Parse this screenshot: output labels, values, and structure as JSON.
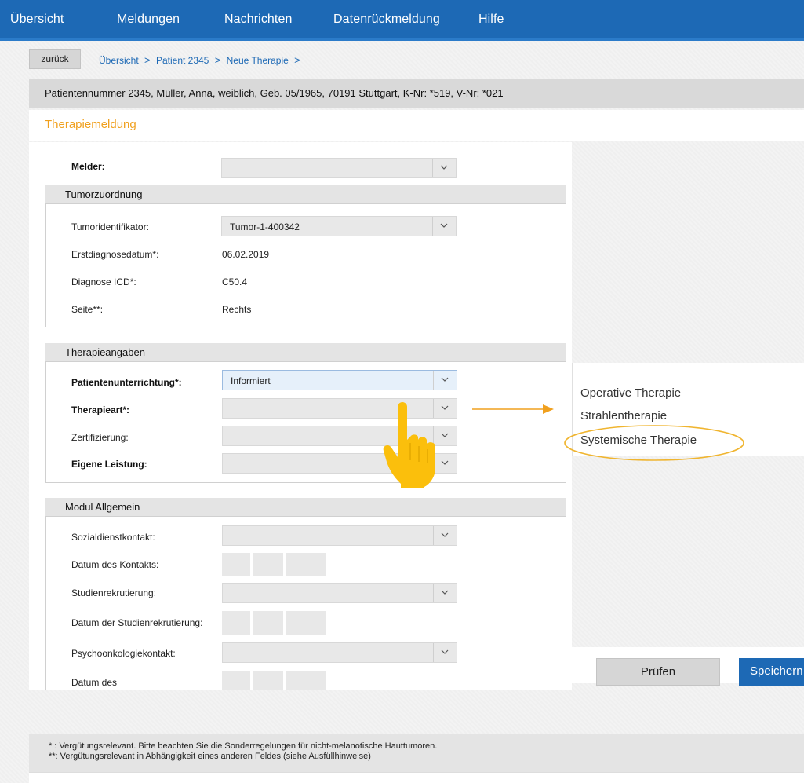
{
  "nav": {
    "items": [
      "Übersicht",
      "Meldungen",
      "Nachrichten",
      "Datenrückmeldung",
      "Hilfe"
    ]
  },
  "toolbar": {
    "back_label": "zurück",
    "breadcrumb": [
      "Übersicht",
      "Patient 2345",
      "Neue Therapie"
    ],
    "separator": ">"
  },
  "patient": {
    "info": "Patientennummer 2345, Müller, Anna, weiblich, Geb. 05/1965, 70191 Stuttgart, K-Nr: *519, V-Nr: *021"
  },
  "page": {
    "title": "Therapiemeldung"
  },
  "form": {
    "melder": {
      "label": "Melder:",
      "value": ""
    },
    "tumor": {
      "heading": "Tumorzuordnung",
      "identifikator_label": "Tumoridentifikator:",
      "identifikator_value": "Tumor-1-400342",
      "erstdiagnose_label": "Erstdiagnosedatum*:",
      "erstdiagnose_value": "06.02.2019",
      "icd_label": "Diagnose ICD*:",
      "icd_value": "C50.4",
      "seite_label": "Seite**:",
      "seite_value": "Rechts"
    },
    "therapie": {
      "heading": "Therapieangaben",
      "unterrichtung_label": "Patientenunterrichtung*:",
      "unterrichtung_value": "Informiert",
      "art_label": "Therapieart*:",
      "zert_label": "Zertifizierung:",
      "eigene_label": "Eigene Leistung:"
    },
    "modul": {
      "heading": "Modul Allgemein",
      "sozial_label": "Sozialdienstkontakt:",
      "datum_kontakt_label": "Datum des Kontakts:",
      "studien_label": "Studienrekrutierung:",
      "datum_studien_label": "Datum der Studienrekrutierung:",
      "psycho_label": "Psychoonkologiekontakt:",
      "datum_psycho_label": "Datum des"
    }
  },
  "therapieart_options": [
    "Operative Therapie",
    "Strahlentherapie",
    "Systemische Therapie"
  ],
  "buttons": {
    "pruefen": "Prüfen",
    "speichern": "Speichern"
  },
  "footer": {
    "note1": "* : Vergütungsrelevant. Bitte beachten Sie die Sonderregelungen für nicht-melanotische Hauttumoren.",
    "note2": "**: Vergütungsrelevant in Abhängigkeit eines anderen Feldes (siehe Ausfüllhinweise)"
  },
  "colors": {
    "brand_blue": "#1d69b5",
    "accent_orange": "#f0a01e",
    "hand_yellow": "#fbbf0c"
  }
}
